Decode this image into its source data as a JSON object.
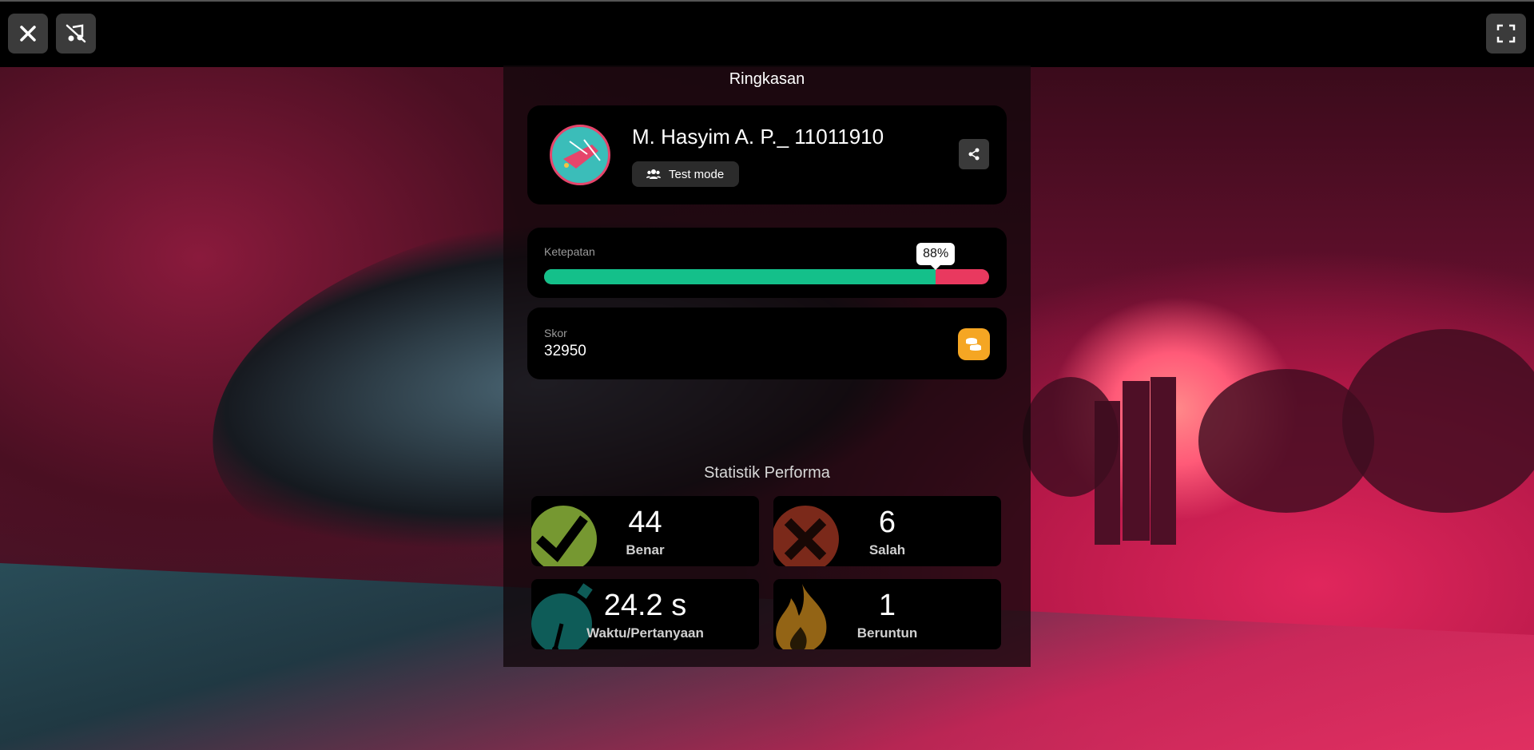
{
  "summary": {
    "title": "Ringkasan",
    "profile": {
      "name": "M. Hasyim A. P._ 11011910",
      "mode_label": "Test mode"
    },
    "accuracy": {
      "label": "Ketepatan",
      "value_text": "88%",
      "fraction": 0.88
    },
    "score": {
      "label": "Skor",
      "value": "32950"
    }
  },
  "stats": {
    "title": "Statistik Performa",
    "items": [
      {
        "value": "44",
        "label": "Benar",
        "icon": "check-icon",
        "color": "#8bb33a"
      },
      {
        "value": "6",
        "label": "Salah",
        "icon": "cross-icon",
        "color": "#e04b2f"
      },
      {
        "value": "24.2 s",
        "label": "Waktu/Pertanyaan",
        "icon": "stopwatch-icon",
        "color": "#1aa7a0"
      },
      {
        "value": "1",
        "label": "Beruntun",
        "icon": "fire-icon",
        "color": "#f5a623"
      }
    ]
  },
  "colors": {
    "accuracy_correct": "#14c08a",
    "accuracy_wrong": "#e9395f",
    "coin": "#f5a623"
  }
}
